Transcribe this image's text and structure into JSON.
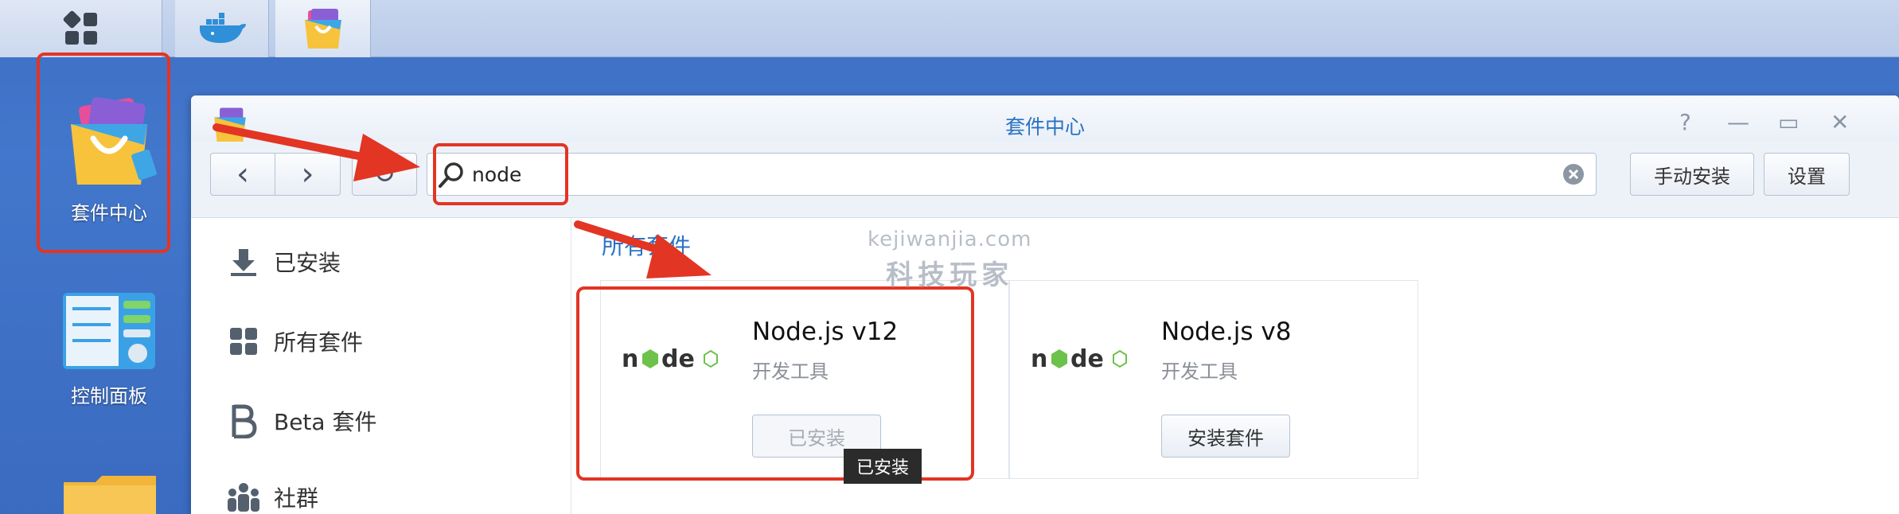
{
  "window": {
    "title": "套件中心",
    "help": "?",
    "minimize": "—",
    "maximize": "▭",
    "close": "✕"
  },
  "toolbar": {
    "back": "‹",
    "forward": "›",
    "refresh": "↻",
    "search_value": "node",
    "manual_install": "手动安装",
    "settings": "设置"
  },
  "desktop": {
    "package_center_label": "套件中心",
    "control_panel_label": "控制面板"
  },
  "sidebar": {
    "items": [
      {
        "label": "已安装",
        "icon": "download-icon"
      },
      {
        "label": "所有套件",
        "icon": "grid-icon"
      },
      {
        "label": "Beta 套件",
        "icon": "beta-icon"
      },
      {
        "label": "社群",
        "icon": "community-icon"
      }
    ]
  },
  "main": {
    "section_title": "所有套件",
    "packages": [
      {
        "name": "Node.js v12",
        "category": "开发工具",
        "button": "已安装",
        "installed": true
      },
      {
        "name": "Node.js v8",
        "category": "开发工具",
        "button": "安装套件",
        "installed": false
      }
    ],
    "tooltip": "已安装"
  },
  "watermark": {
    "line1": "kejiwanjia.com",
    "line2": "科技玩家"
  },
  "colors": {
    "accent": "#2a72c4",
    "annotation_red": "#e23524",
    "desktop_blue": "#3f74c9"
  }
}
